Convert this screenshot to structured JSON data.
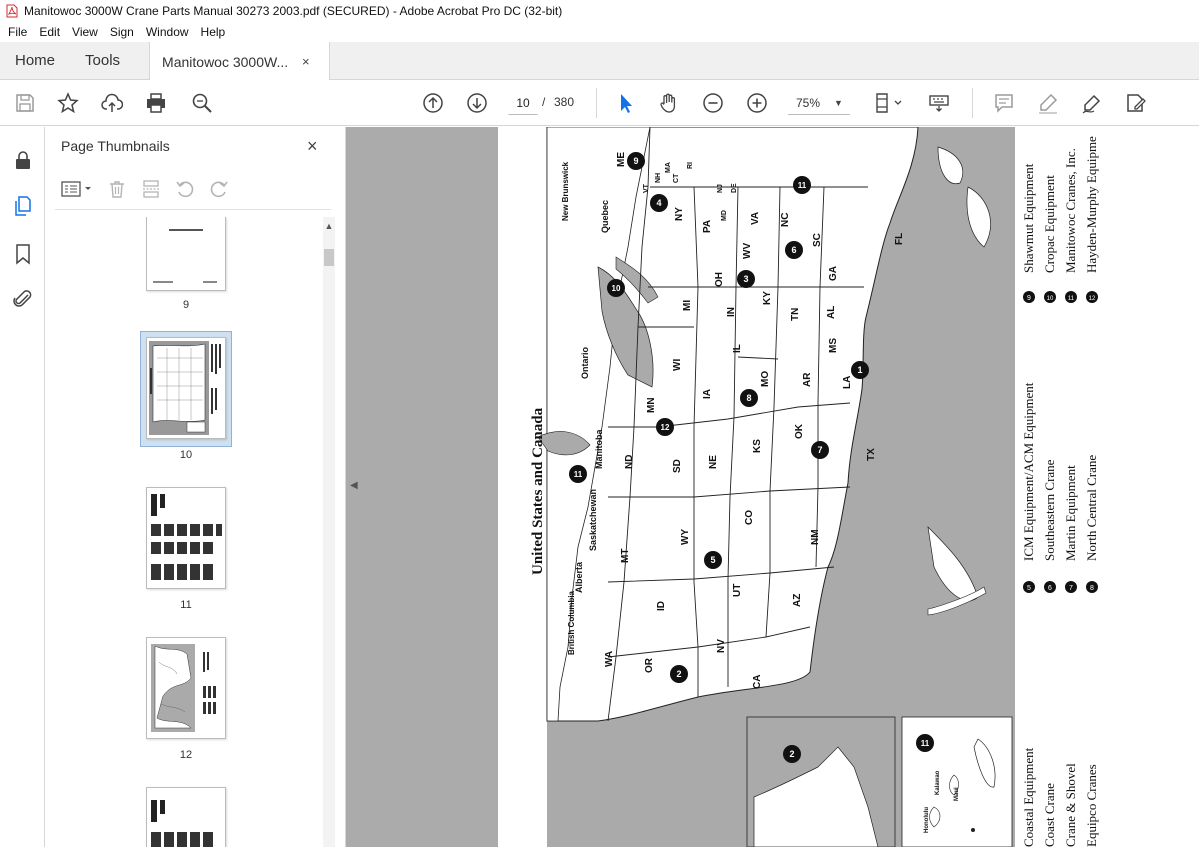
{
  "window": {
    "title": "Manitowoc 3000W Crane Parts Manual 30273 2003.pdf (SECURED) - Adobe Acrobat Pro DC (32-bit)"
  },
  "menu": [
    "File",
    "Edit",
    "View",
    "Sign",
    "Window",
    "Help"
  ],
  "tabs": {
    "home": "Home",
    "tools": "Tools",
    "document": "Manitowoc 3000W...",
    "close_glyph": "×"
  },
  "toolbar": {
    "current_page": "10",
    "page_separator": "/",
    "total_pages": "380",
    "zoom": "75%"
  },
  "thumbnails_panel": {
    "title": "Page Thumbnails",
    "close_glyph": "×",
    "pages": [
      {
        "label": "9"
      },
      {
        "label": "10",
        "selected": true
      },
      {
        "label": "11"
      },
      {
        "label": "12"
      }
    ]
  },
  "document": {
    "map_title": "United States and Canada",
    "states": [
      "ME",
      "VT",
      "NH",
      "MA",
      "CT",
      "RI",
      "NY",
      "PA",
      "NJ",
      "MD",
      "DE",
      "VA",
      "WV",
      "NC",
      "SC",
      "GA",
      "FL",
      "OH",
      "KY",
      "TN",
      "AL",
      "MS",
      "LA",
      "MI",
      "IN",
      "IL",
      "WI",
      "MN",
      "IA",
      "MO",
      "AR",
      "ND",
      "SD",
      "NE",
      "KS",
      "OK",
      "TX",
      "MT",
      "WY",
      "CO",
      "NM",
      "ID",
      "UT",
      "AZ",
      "WA",
      "OR",
      "NV",
      "CA"
    ],
    "provinces": [
      "New Brunswick",
      "Quebec",
      "Ontario",
      "Manitoba",
      "Saskatchewan",
      "Alberta",
      "British Columbia"
    ],
    "hawaii_labels": [
      "Honolulu",
      "Kalawao",
      "Maui"
    ],
    "dealer_numbers": [
      "1",
      "2",
      "3",
      "4",
      "5",
      "6",
      "7",
      "8",
      "9",
      "10",
      "11",
      "12"
    ],
    "legend_right": [
      {
        "num": "9",
        "name": "Shawmut Equipment"
      },
      {
        "num": "10",
        "name": "Cropac Equipment"
      },
      {
        "num": "11",
        "name": "Manitowoc Cranes, Inc."
      },
      {
        "num": "12",
        "name": "Hayden-Murphy Equipme"
      }
    ],
    "legend_mid": [
      {
        "num": "5",
        "name": "ICM Equipment/ACM Equipment"
      },
      {
        "num": "6",
        "name": "Southeastern Crane"
      },
      {
        "num": "7",
        "name": "Martin Equipment"
      },
      {
        "num": "8",
        "name": "North Central Crane"
      }
    ],
    "legend_left": [
      {
        "name": "Coastal Equipment"
      },
      {
        "name": "Coast Crane"
      },
      {
        "name": "Crane & Shovel"
      },
      {
        "name": "Equipco Cranes"
      }
    ]
  }
}
